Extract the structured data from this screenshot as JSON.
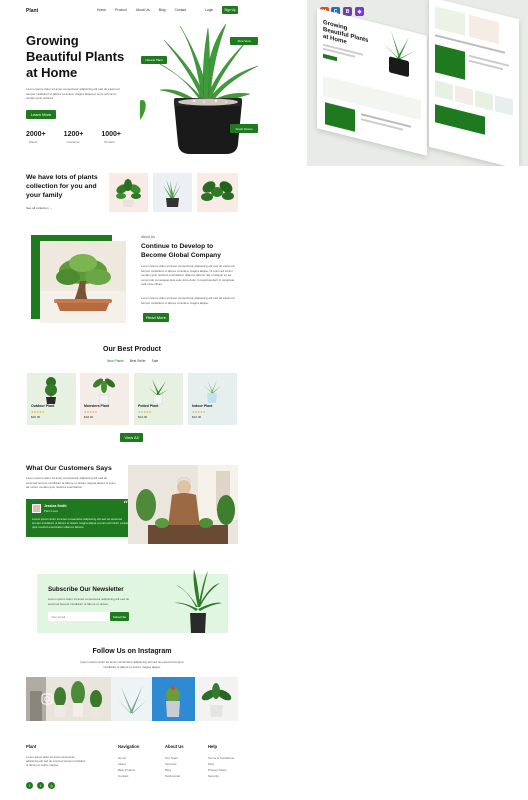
{
  "nav": {
    "logo": "Plant",
    "links": [
      "Home",
      "Product",
      "About Us",
      "Blog",
      "Contact"
    ],
    "login": "Login",
    "cta": "Sign Up"
  },
  "hero": {
    "title_l1": "Growing",
    "title_l2": "Beautiful Plants",
    "title_l3": "at Home",
    "desc": "Lorem ipsum dolor sit amet consectetur adipiscing elit sed do eiusmod tempor incididunt ut labore et dolore magna aliqua ut enim ad minim veniam quis nostrud",
    "button": "Learn More",
    "tag_top": "Aloe Vera",
    "tag_left": "Natural Plant",
    "tag_bottom": "Fresh Green",
    "stats": [
      {
        "num": "2000+",
        "label": "Plants"
      },
      {
        "num": "1200+",
        "label": "Customer"
      },
      {
        "num": "1000+",
        "label": "Product"
      }
    ]
  },
  "collection": {
    "title_l1": "We have lots of plants",
    "title_l2": "collection for you and",
    "title_l3": "your family",
    "link": "See all collection →"
  },
  "about": {
    "kicker": "About Us",
    "title_l1": "Continue to Develop to",
    "title_l2": "Become Global Company",
    "p1": "Lorem ipsum dolor sit amet consectetur adipiscing elit sed do eiusmod tempor incididunt ut labore et dolore magna aliqua. Ut enim ad minim veniam quis nostrud exercitation ullamco laboris nisi ut aliquip ex ea commodo consequat duis aute irure dolor in reprehenderit in voluptate velit esse cillum.",
    "p2": "Lorem ipsum dolor sit amet consectetur adipiscing elit sed do eiusmod tempor incididunt ut labore et dolore magna aliqua.",
    "button": "Read More"
  },
  "products": {
    "title": "Our Best Product",
    "tabs": [
      "New Plants",
      "Best Seller",
      "Sale"
    ],
    "items": [
      {
        "name": "Outdoor Plant",
        "stars": "★★★★★",
        "price": "$20.00",
        "bg": "#e6f1e2"
      },
      {
        "name": "Monstera Plant",
        "stars": "★★★★★",
        "price": "$18.00",
        "bg": "#f4ece6"
      },
      {
        "name": "Potted Plant",
        "stars": "★★★★★",
        "price": "$24.00",
        "bg": "#e6f1e2"
      },
      {
        "name": "Indoor Plant",
        "stars": "★★★★★",
        "price": "$16.00",
        "bg": "#e7efee"
      }
    ],
    "button": "View All"
  },
  "testimonials": {
    "title": "What Our Customers Says",
    "desc": "Lorem ipsum dolor sit amet consectetur adipiscing elit sed do eiusmod tempor incididunt ut labore et dolore magna aliqua ut enim ad minim veniam quis nostrud exercitation.",
    "name": "Jessica Smith",
    "role": "Plant Lover",
    "quote": "Lorem ipsum dolor sit amet consectetur adipiscing elit sed do eiusmod tempor incididunt ut labore et dolore magna aliqua ut enim ad minim veniam quis nostrud exercitation ullamco laboris."
  },
  "newsletter": {
    "title": "Subscribe Our Newsletter",
    "desc": "Lorem ipsum dolor sit amet consectetur adipiscing elit sed do eiusmod tempor incididunt ut labore et dolore.",
    "placeholder": "Your email",
    "button": "Subscribe"
  },
  "instagram": {
    "title": "Follow Us on Instagram",
    "desc": "Lorem ipsum dolor sit amet consectetur adipiscing elit sed do eiusmod tempor incididunt ut labore et dolore magna aliqua."
  },
  "footer": {
    "brand": "Plant",
    "brand_desc": "Lorem ipsum dolor sit amet consectetur adipiscing elit sed do eiusmod tempor incididunt ut labore et dolore magna.",
    "col1_title": "Navigation",
    "col1": [
      "Home",
      "About",
      "Best Product",
      "Contact"
    ],
    "col2_title": "About Us",
    "col2": [
      "Our Team",
      "Services",
      "Blog",
      "Testimonial"
    ],
    "col3_title": "Help",
    "col3": [
      "Terms & Conditions",
      "FAQ",
      "Privacy Policy",
      "Security"
    ]
  },
  "badges": [
    "H",
    "C",
    "B"
  ],
  "colors": {
    "accent": "#1f7a1f",
    "mint": "#e1f6e1",
    "light": "#f3f5f1"
  }
}
